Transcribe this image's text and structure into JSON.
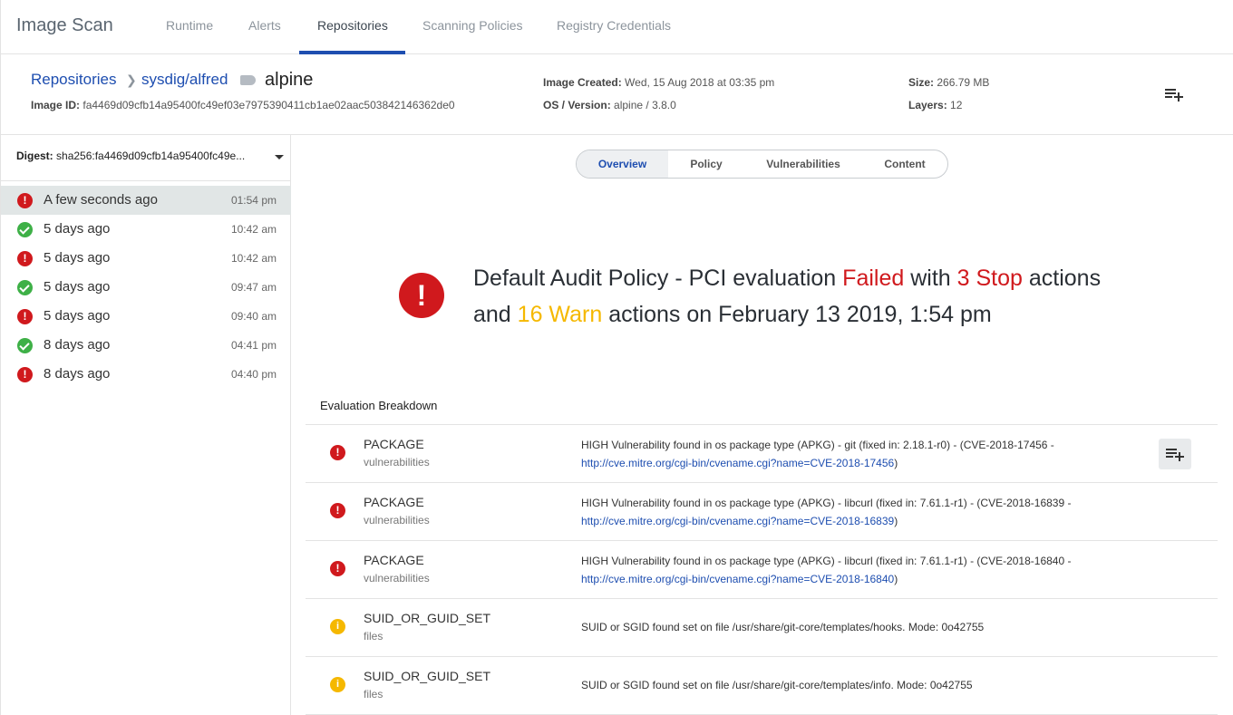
{
  "app": {
    "title": "Image Scan"
  },
  "nav": {
    "tabs": [
      {
        "label": "Runtime"
      },
      {
        "label": "Alerts"
      },
      {
        "label": "Repositories"
      },
      {
        "label": "Scanning Policies"
      },
      {
        "label": "Registry Credentials"
      }
    ],
    "active": "Repositories"
  },
  "header": {
    "breadcrumb": [
      "Repositories",
      "sysdig/alfred"
    ],
    "tag": "alpine",
    "image_id_label": "Image ID:",
    "image_id": "fa4469d09cfb14a95400fc49ef03e7975390411cb1ae02aac503842146362de0",
    "image_created_label": "Image Created:",
    "image_created": "Wed, 15 Aug 2018 at 03:35 pm",
    "os_version_label": "OS / Version:",
    "os_version": "alpine / 3.8.0",
    "size_label": "Size:",
    "size": "266.79 MB",
    "layers_label": "Layers:",
    "layers": "12",
    "add_icon": "playlist-add-icon"
  },
  "sidebar": {
    "digest_label": "Digest:",
    "digest": "sha256:fa4469d09cfb14a95400fc49e...",
    "scans": [
      {
        "label": "A few seconds ago",
        "time": "01:54 pm",
        "status": "fail"
      },
      {
        "label": "5 days ago",
        "time": "10:42 am",
        "status": "pass"
      },
      {
        "label": "5 days ago",
        "time": "10:42 am",
        "status": "fail"
      },
      {
        "label": "5 days ago",
        "time": "09:47 am",
        "status": "pass"
      },
      {
        "label": "5 days ago",
        "time": "09:40 am",
        "status": "fail"
      },
      {
        "label": "8 days ago",
        "time": "04:41 pm",
        "status": "pass"
      },
      {
        "label": "8 days ago",
        "time": "04:40 pm",
        "status": "fail"
      }
    ]
  },
  "content_tabs": {
    "items": [
      "Overview",
      "Policy",
      "Vulnerabilities",
      "Content"
    ],
    "active": "Overview"
  },
  "summary": {
    "part1": "Default Audit Policy - PCI evaluation",
    "result": "Failed",
    "part2": "with",
    "stop": "3 Stop",
    "part3": "actions and",
    "warn": "16 Warn",
    "part4": "actions on February 13 2019, 1:54 pm"
  },
  "breakdown": {
    "title": "Evaluation Breakdown",
    "rows": [
      {
        "gate": "PACKAGE",
        "trigger": "vulnerabilities",
        "severity": "stop",
        "message": "HIGH Vulnerability found in os package type (APKG) - git (fixed in: 2.18.1-r0) - (CVE-2018-17456 -",
        "link": "http://cve.mitre.org/cgi-bin/cvename.cgi?name=CVE-2018-17456",
        "suffix": ")"
      },
      {
        "gate": "PACKAGE",
        "trigger": "vulnerabilities",
        "severity": "stop",
        "message": "HIGH Vulnerability found in os package type (APKG) - libcurl (fixed in: 7.61.1-r1) - (CVE-2018-16839 -",
        "link": "http://cve.mitre.org/cgi-bin/cvename.cgi?name=CVE-2018-16839",
        "suffix": ")"
      },
      {
        "gate": "PACKAGE",
        "trigger": "vulnerabilities",
        "severity": "stop",
        "message": "HIGH Vulnerability found in os package type (APKG) - libcurl (fixed in: 7.61.1-r1) - (CVE-2018-16840 -",
        "link": "http://cve.mitre.org/cgi-bin/cvename.cgi?name=CVE-2018-16840",
        "suffix": ")"
      },
      {
        "gate": "SUID_OR_GUID_SET",
        "trigger": "files",
        "severity": "warn",
        "message": "SUID or SGID found set on file /usr/share/git-core/templates/hooks. Mode: 0o42755",
        "link": "",
        "suffix": ""
      },
      {
        "gate": "SUID_OR_GUID_SET",
        "trigger": "files",
        "severity": "warn",
        "message": "SUID or SGID found set on file /usr/share/git-core/templates/info. Mode: 0o42755",
        "link": "",
        "suffix": ""
      }
    ]
  },
  "colors": {
    "accent": "#1e4eb0",
    "fail": "#d0191d",
    "pass": "#3eb047",
    "warn": "#f5b800"
  }
}
